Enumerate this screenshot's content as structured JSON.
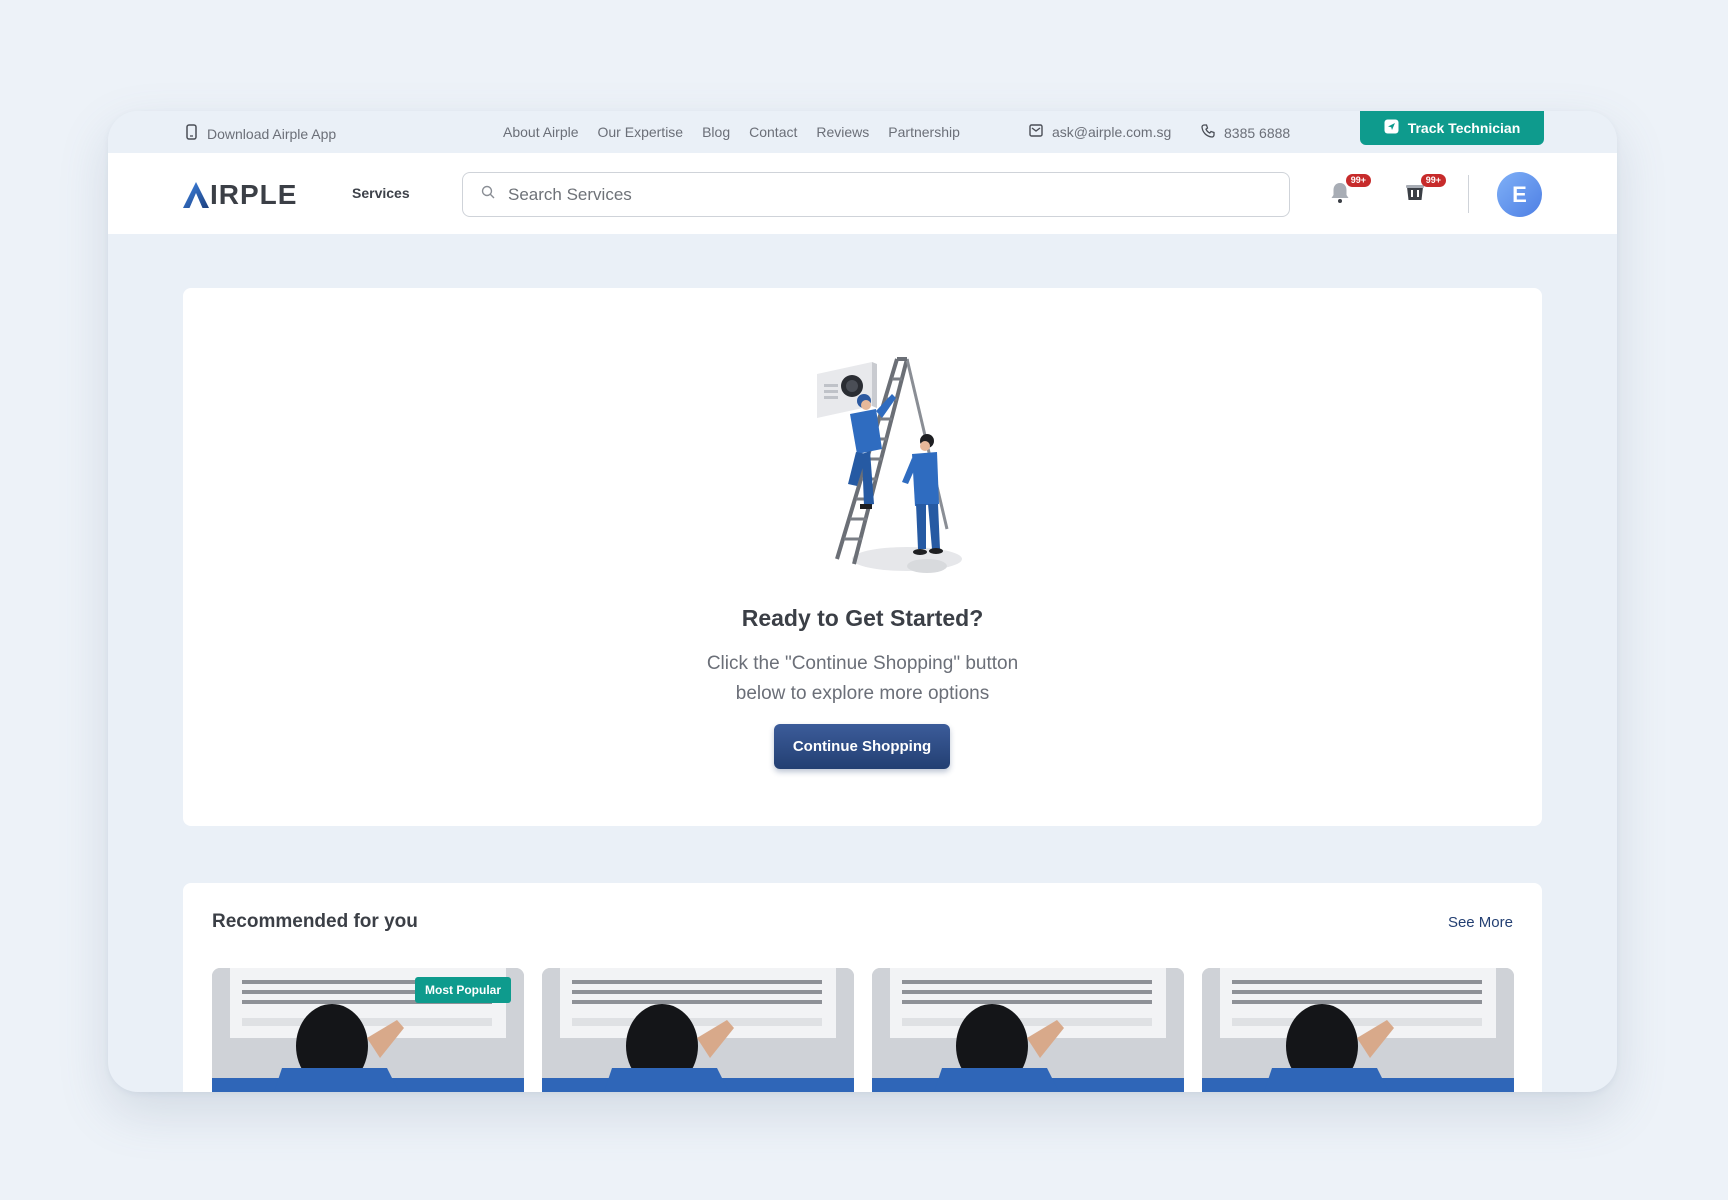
{
  "topbar": {
    "download_label": "Download Airple App",
    "links": [
      "About Airple",
      "Our Expertise",
      "Blog",
      "Contact",
      "Reviews",
      "Partnership"
    ],
    "email": "ask@airple.com.sg",
    "phone": "8385 6888",
    "track_label": "Track Technician"
  },
  "nav": {
    "logo_text": "IRPLE",
    "services_label": "Services",
    "search_placeholder": "Search Services",
    "notifications_badge": "99+",
    "cart_badge": "99+",
    "avatar_initial": "E"
  },
  "hero": {
    "title": "Ready to Get Started?",
    "subtitle_line1": "Click the \"Continue Shopping\" button",
    "subtitle_line2": "below to explore more options",
    "button_label": "Continue Shopping"
  },
  "recommended": {
    "title": "Recommended for you",
    "see_more": "See More",
    "popular_tag": "Most Popular"
  },
  "colors": {
    "primary": "#233f72",
    "accent": "#0e9b8d",
    "badge": "#c72b2b",
    "background": "#eaf0f7"
  },
  "icons": {
    "download": "phone-icon",
    "email": "mail-icon",
    "phone": "phone-call-icon",
    "track": "navigation-icon",
    "search": "search-icon",
    "notifications": "bell-icon",
    "cart": "cart-icon"
  }
}
